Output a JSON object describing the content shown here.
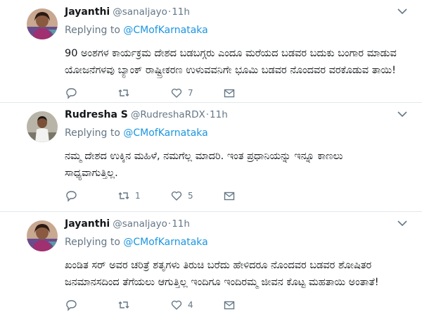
{
  "tweets": [
    {
      "name": "Jayanthi",
      "handle": "@sanaljayo",
      "time": "11h",
      "replying_prefix": "Replying to ",
      "replying_to": "@CMofKarnataka",
      "lines": [
        "90 ಅಂಶಗಳ ಕಾರ್ಯಕ್ರಮ ದೇಶದ ಬಡಬಗ್ಗರು ಎಂದೂ ಮರೆಯದ ಬಡವರ ಬದುಕು ಬಂಗಾರ ಮಾಡುವ",
        "ಯೋಜನೆಗಳವು ಬ್ಯಾಂಕ್ ರಾಷ್ಟ್ರೀಕರಣ ಉಳುವವನಿಗೇ ಭೂಮಿ ಬಡವರ ನೊಂದವರ ವರಕೊಡುವ ತಾಯಿ!"
      ],
      "replies": "",
      "retweets": "",
      "likes": "7"
    },
    {
      "name": "Rudresha S",
      "handle": "@RudreshaRDX",
      "time": "11h",
      "replying_prefix": "Replying to ",
      "replying_to": "@CMofKarnataka",
      "lines": [
        "ನಮ್ಮ ದೇಶದ ಉಕ್ಕಿನ ಮಹಿಳೆ, ನಮಗೆಲ್ಲ ಮಾದರಿ. ಇಂತ ಪ್ರಧಾನಿಯನ್ನು ಇನ್ನೂ ಕಾಣಲು",
        "ಸಾಧ್ಯವಾಗುತ್ತಿಲ್ಲ."
      ],
      "replies": "",
      "retweets": "1",
      "likes": "5"
    },
    {
      "name": "Jayanthi",
      "handle": "@sanaljayo",
      "time": "11h",
      "replying_prefix": "Replying to ",
      "replying_to": "@CMofKarnataka",
      "lines": [
        "ಖಂಡಿತ ಸರ್ ಅವರ ಚರಿತ್ರೆ ಶತೃಗಳು ತಿರುಚಿ ಬರೆದು ಹೇಳಿದರೂ ನೊಂದವರ ಬಡವರ ಶೋಷಿತರ",
        "ಜನಮಾನಸದಿಂದ ತೆಗೆಯಲು ಆಗುತ್ತಿಲ್ಲ ಇಂದಿಗೂ ಇಂದಿರಮ್ಮ ಜೀವನ ಕೊಟ್ಟ ಮಹತಾಯಿ ಅಂತಾತೆ!"
      ],
      "replies": "",
      "retweets": "",
      "likes": "4"
    }
  ],
  "icons": {
    "reply": "reply-icon",
    "retweet": "retweet-icon",
    "like": "heart-icon",
    "message": "envelope-icon",
    "more": "chevron-down-icon"
  },
  "colors": {
    "secondary_text": "#657786",
    "link": "#1b95e0",
    "divider": "#e1e8ed"
  }
}
